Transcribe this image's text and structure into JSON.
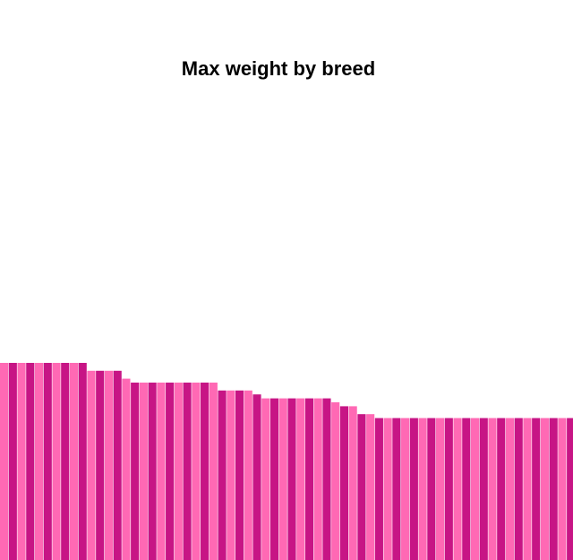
{
  "chart_data": {
    "type": "bar",
    "title": "Max weight by breed",
    "xlabel": "",
    "ylabel": "",
    "grid": false,
    "legend": "none",
    "series": [
      {
        "values": [
          100,
          100,
          100,
          100,
          100,
          100,
          100,
          100,
          100,
          100,
          96,
          96,
          96,
          96,
          92,
          90,
          90,
          90,
          90,
          90,
          90,
          90,
          90,
          90,
          90,
          86,
          86,
          86,
          86,
          84,
          82,
          82,
          82,
          82,
          82,
          82,
          82,
          82,
          80,
          78,
          78,
          74,
          74,
          72,
          72,
          72,
          72,
          72,
          72,
          72,
          72,
          72,
          72,
          72,
          72,
          72,
          72,
          72,
          72,
          72,
          72,
          72,
          72,
          72,
          72,
          72,
          72,
          72,
          72,
          72,
          70,
          68,
          66,
          64,
          64,
          64
        ]
      }
    ],
    "colors": [
      "#ff69b4",
      "#c71585"
    ]
  }
}
